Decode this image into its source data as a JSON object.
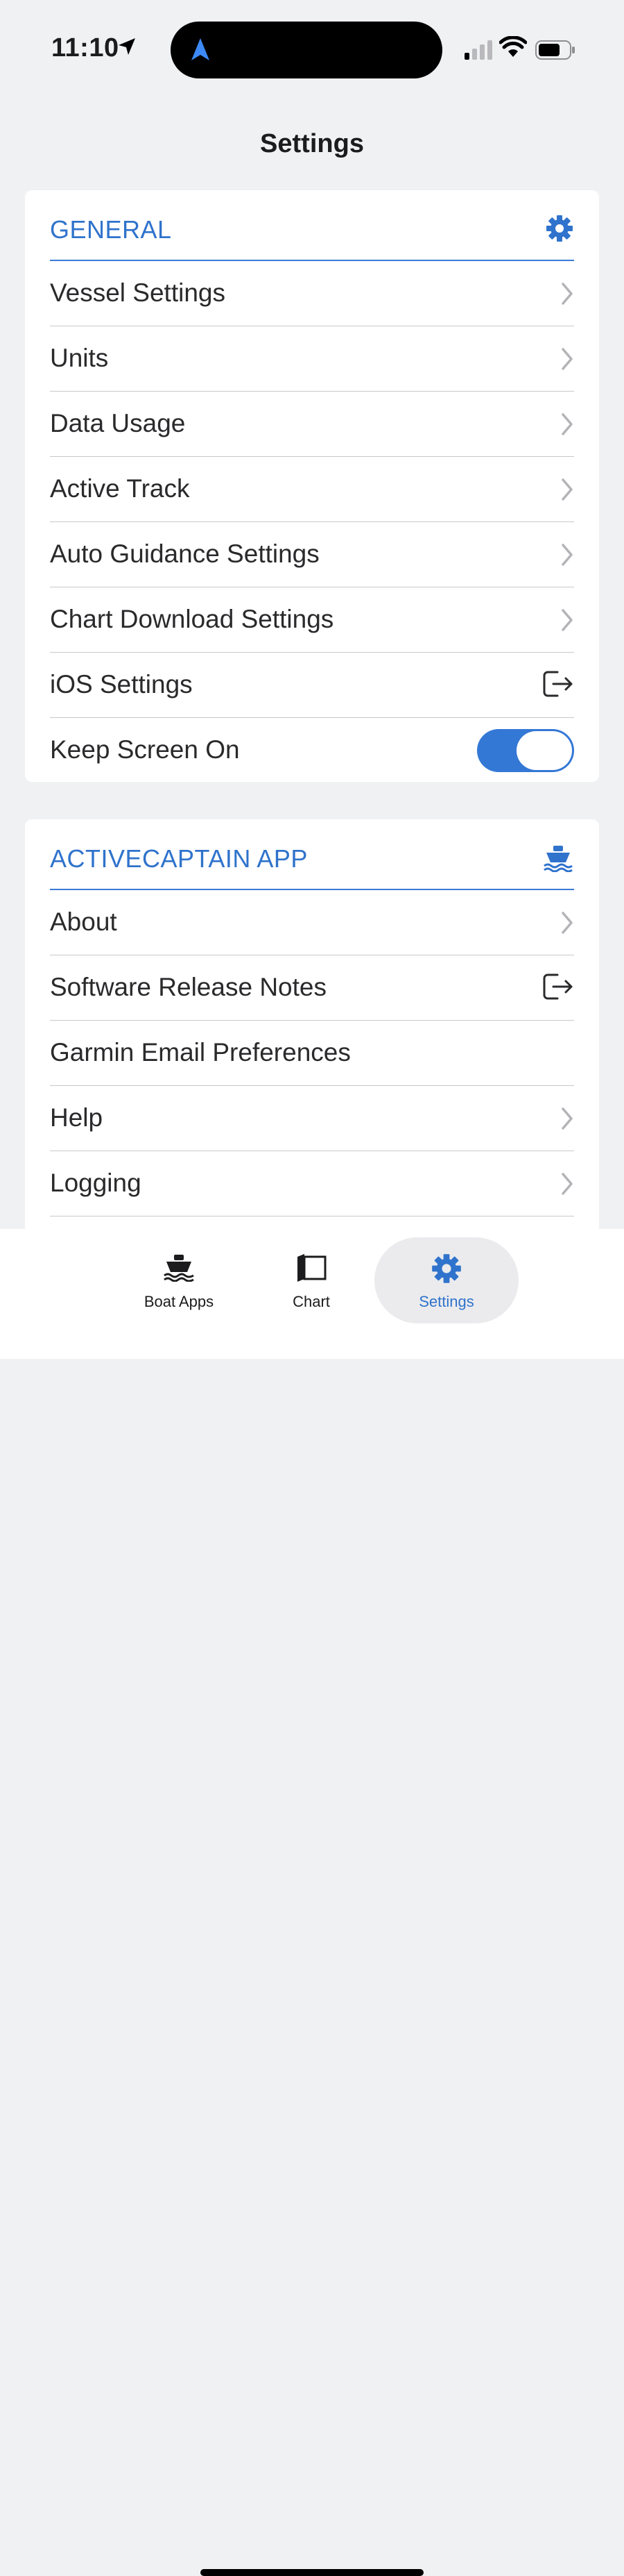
{
  "status_bar": {
    "time": "11:10",
    "icons": [
      "location-arrow-icon",
      "navigation-arrow-icon",
      "cellular-signal-icon",
      "wifi-icon",
      "battery-icon"
    ]
  },
  "page_title": "Settings",
  "accent_color": "#2f73cc",
  "sections": [
    {
      "title": "GENERAL",
      "icon": "gear-icon",
      "rows": [
        {
          "label": "Vessel Settings",
          "accessory": "chevron"
        },
        {
          "label": "Units",
          "accessory": "chevron"
        },
        {
          "label": "Data Usage",
          "accessory": "chevron"
        },
        {
          "label": "Active Track",
          "accessory": "chevron"
        },
        {
          "label": "Auto Guidance Settings",
          "accessory": "chevron"
        },
        {
          "label": "Chart Download Settings",
          "accessory": "chevron"
        },
        {
          "label": "iOS Settings",
          "accessory": "external-link"
        },
        {
          "label": "Keep Screen On",
          "accessory": "toggle",
          "on": true
        }
      ]
    },
    {
      "title": "ACTIVECAPTAIN APP",
      "icon": "boat-icon",
      "rows": [
        {
          "label": "About",
          "accessory": "chevron"
        },
        {
          "label": "Software Release Notes",
          "accessory": "external-link"
        },
        {
          "label": "Garmin Email Preferences",
          "accessory": "none"
        },
        {
          "label": "Help",
          "accessory": "chevron"
        },
        {
          "label": "Logging",
          "accessory": "chevron"
        }
      ]
    }
  ],
  "tab_bar": {
    "tabs": [
      {
        "label": "Boat Apps",
        "icon": "boat-icon",
        "selected": false
      },
      {
        "label": "Chart",
        "icon": "chart-book-icon",
        "selected": false
      },
      {
        "label": "Settings",
        "icon": "gear-icon",
        "selected": true
      }
    ]
  }
}
